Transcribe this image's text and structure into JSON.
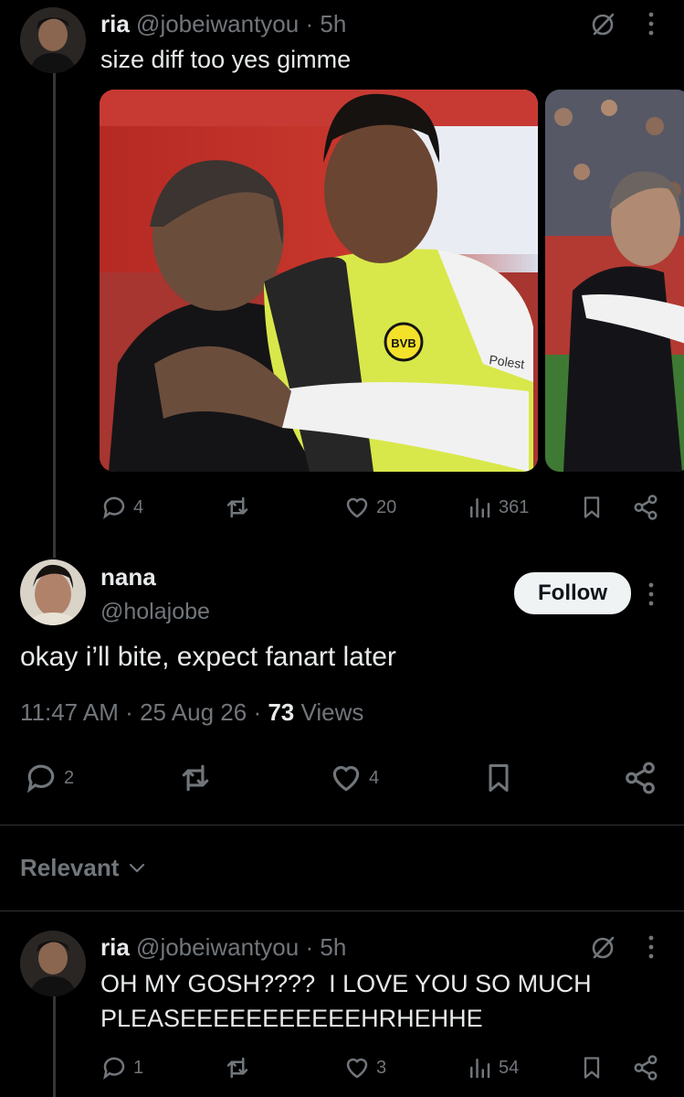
{
  "tweet1": {
    "name": "ria",
    "handle": "@jobeiwantyou",
    "sep": "·",
    "time": "5h",
    "text": "size diff too yes gimme",
    "photo1_text": {
      "badge": "BVB",
      "sponsor": "Polest"
    },
    "stats": {
      "replies": "4",
      "likes": "20",
      "views": "361"
    }
  },
  "main_tweet": {
    "name": "nana",
    "handle": "@holajobe",
    "follow_label": "Follow",
    "text": "okay i’ll bite, expect fanart later",
    "time": "11:47 AM",
    "sep1": "·",
    "date": "25 Aug 26",
    "sep2": "·",
    "views_count": "73",
    "views_label": "Views",
    "stats": {
      "replies": "2",
      "likes": "4"
    }
  },
  "sort": {
    "label": "Relevant"
  },
  "reply1": {
    "name": "ria",
    "handle": "@jobeiwantyou",
    "sep": "·",
    "time": "5h",
    "text_line1": "OH MY GOSH????  I LOVE YOU SO MUCH",
    "text_line2": "PLEASEEEEEEEEEEEHRHEHHE",
    "stats": {
      "replies": "1",
      "likes": "3",
      "views": "54"
    }
  },
  "icons": {
    "grok": "grok-icon",
    "more": "more-icon",
    "reply": "reply-icon",
    "retweet": "retweet-icon",
    "like": "like-icon",
    "views": "views-icon",
    "bookmark": "bookmark-icon",
    "share": "share-icon",
    "chevron": "chevron-down-icon"
  },
  "colors": {
    "background": "#000000",
    "text": "#e7e9ea",
    "muted": "#71767b",
    "divider": "#2f3336"
  }
}
